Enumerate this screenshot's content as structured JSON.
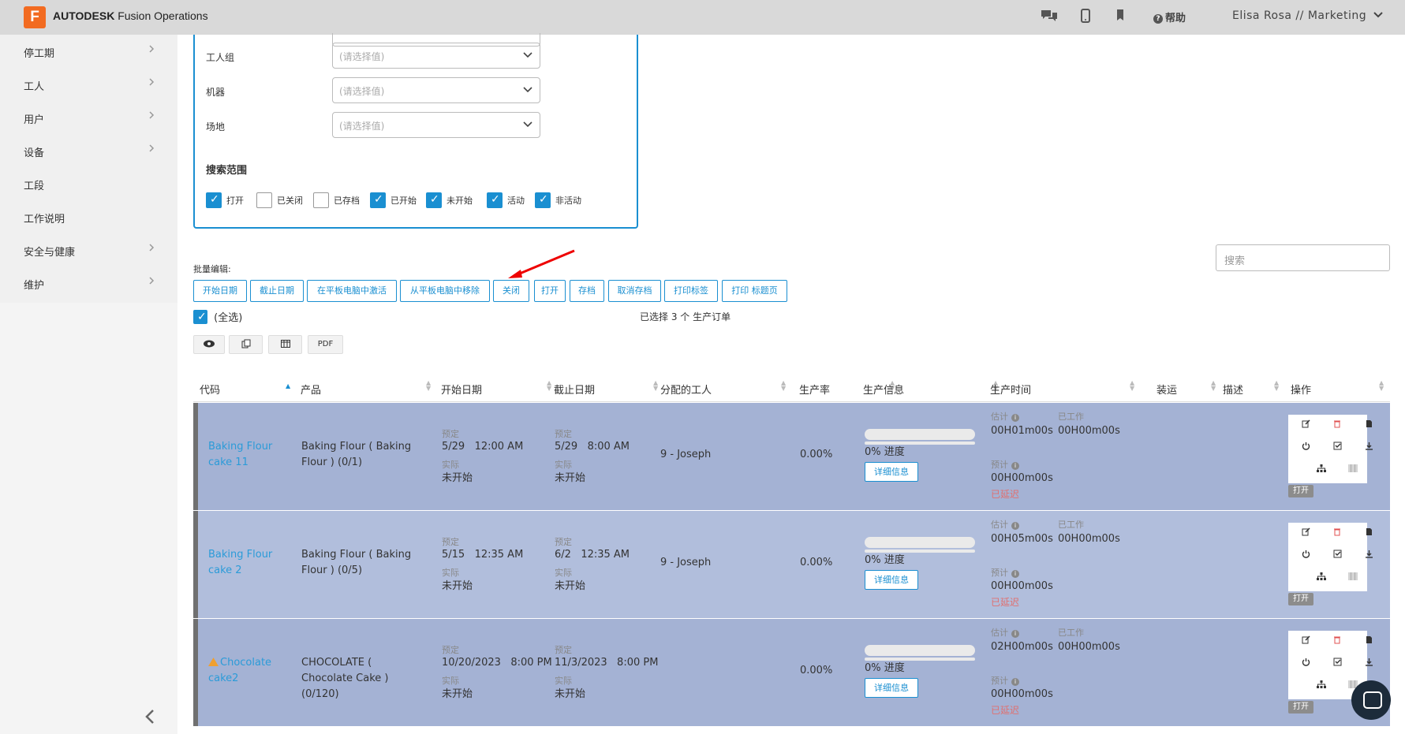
{
  "app": {
    "logo_letter": "F",
    "brand_bold": "AUTODESK",
    "brand_rest": "Fusion Operations"
  },
  "topbar": {
    "help_label": "帮助",
    "user": "Elisa Rosa // Marketing"
  },
  "sidebar": {
    "items": [
      {
        "label": "停工期",
        "has_children": true
      },
      {
        "label": "工人",
        "has_children": true
      },
      {
        "label": "用户",
        "has_children": true
      },
      {
        "label": "设备",
        "has_children": true
      },
      {
        "label": "工段",
        "has_children": false
      },
      {
        "label": "工作说明",
        "has_children": false
      },
      {
        "label": "安全与健康",
        "has_children": true
      },
      {
        "label": "维护",
        "has_children": true
      }
    ]
  },
  "filters": {
    "fields": [
      {
        "label": "工人组",
        "placeholder": "(请选择值)"
      },
      {
        "label": "机器",
        "placeholder": "(请选择值)"
      },
      {
        "label": "场地",
        "placeholder": "(请选择值)"
      }
    ],
    "scope_title": "搜索范围",
    "scope": [
      {
        "label": "打开",
        "checked": true
      },
      {
        "label": "已关闭",
        "checked": false
      },
      {
        "label": "已存档",
        "checked": false
      },
      {
        "label": "已开始",
        "checked": true
      },
      {
        "label": "未开始",
        "checked": true
      },
      {
        "label": "活动",
        "checked": true
      },
      {
        "label": "非活动",
        "checked": true
      }
    ]
  },
  "batch": {
    "label": "批量编辑:",
    "buttons": [
      "开始日期",
      "截止日期",
      "在平板电脑中激活",
      "从平板电脑中移除",
      "关闭",
      "打开",
      "存档",
      "取消存档",
      "打印标签",
      "打印 标题页"
    ]
  },
  "search": {
    "placeholder": "搜索"
  },
  "select_all": {
    "label": "(全选)",
    "checked": true
  },
  "selected_info": "已选择 3 个 生产订单",
  "tools": {
    "pdf": "PDF"
  },
  "table": {
    "headers": [
      "代码",
      "产品",
      "开始日期",
      "截止日期",
      "分配的工人",
      "生产率",
      "生产信息",
      "生产时间",
      "装运",
      "描述",
      "操作"
    ],
    "labels": {
      "planned": "预定",
      "actual": "实际",
      "not_started": "未开始",
      "progress_suffix": "进度",
      "detail": "详细信息",
      "estimate": "估计",
      "worked": "已工作",
      "forecast": "预计",
      "delayed": "已延迟",
      "open": "打开"
    },
    "rows": [
      {
        "code": "Baking Flour cake 11",
        "warning": false,
        "product": "Baking Flour ( Baking Flour ) (0/1)",
        "start_planned": "5/29   12:00 AM",
        "start_actual": "未开始",
        "due_planned": "5/29   8:00 AM",
        "due_actual": "未开始",
        "worker": "9 - Joseph",
        "rate": "0.00%",
        "progress": "0%",
        "estimate": "00H01m00s",
        "worked": "00H00m00s",
        "forecast": "00H00m00s"
      },
      {
        "code": "Baking Flour cake 2",
        "warning": false,
        "product": "Baking Flour ( Baking Flour ) (0/5)",
        "start_planned": "5/15   12:35 AM",
        "start_actual": "未开始",
        "due_planned": "6/2   12:35 AM",
        "due_actual": "未开始",
        "worker": "9 - Joseph",
        "rate": "0.00%",
        "progress": "0%",
        "estimate": "00H05m00s",
        "worked": "00H00m00s",
        "forecast": "00H00m00s"
      },
      {
        "code": "Chocolate cake2",
        "warning": true,
        "product": "CHOCOLATE ( Chocolate Cake ) (0/120)",
        "start_planned": "10/20/2023   8:00 PM",
        "start_actual": "未开始",
        "due_planned": "11/3/2023   8:00 PM",
        "due_actual": "未开始",
        "worker": "",
        "rate": "0.00%",
        "progress": "0%",
        "estimate": "02H00m00s",
        "worked": "00H00m00s",
        "forecast": "00H00m00s"
      }
    ]
  }
}
